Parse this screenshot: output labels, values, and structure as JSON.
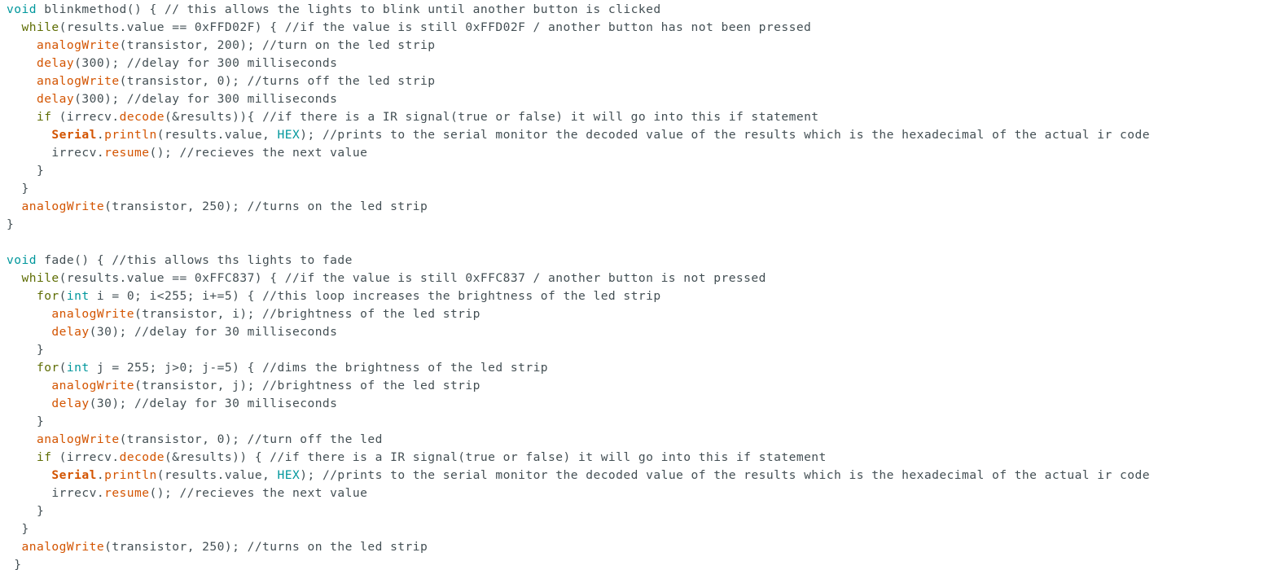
{
  "theme": {
    "background": "#ffffff",
    "default_text": "#434f54",
    "type_color": "#00979c",
    "keyword_color": "#5e6d03",
    "function_color": "#d35400",
    "constant_color": "#00979c"
  },
  "code_lines": [
    [
      [
        "type",
        "void"
      ],
      [
        "text",
        " blinkmethod() { // this allows the lights to blink until another button is clicked"
      ]
    ],
    [
      [
        "text",
        "  "
      ],
      [
        "keyword",
        "while"
      ],
      [
        "text",
        "(results.value == 0xFFD02F) { //if the value is still 0xFFD02F / another button has not been pressed"
      ]
    ],
    [
      [
        "text",
        "    "
      ],
      [
        "func",
        "analogWrite"
      ],
      [
        "text",
        "(transistor, 200); //turn on the led strip"
      ]
    ],
    [
      [
        "text",
        "    "
      ],
      [
        "func",
        "delay"
      ],
      [
        "text",
        "(300); //delay for 300 milliseconds"
      ]
    ],
    [
      [
        "text",
        "    "
      ],
      [
        "func",
        "analogWrite"
      ],
      [
        "text",
        "(transistor, 0); //turns off the led strip"
      ]
    ],
    [
      [
        "text",
        "    "
      ],
      [
        "func",
        "delay"
      ],
      [
        "text",
        "(300); //delay for 300 milliseconds"
      ]
    ],
    [
      [
        "text",
        "    "
      ],
      [
        "keyword",
        "if"
      ],
      [
        "text",
        " (irrecv."
      ],
      [
        "func",
        "decode"
      ],
      [
        "text",
        "(&results)){ //if there is a IR signal(true or false) it will go into this if statement"
      ]
    ],
    [
      [
        "text",
        "      "
      ],
      [
        "serial",
        "Serial"
      ],
      [
        "text",
        "."
      ],
      [
        "func",
        "println"
      ],
      [
        "text",
        "(results.value, "
      ],
      [
        "const",
        "HEX"
      ],
      [
        "text",
        "); //prints to the serial monitor the decoded value of the results which is the hexadecimal of the actual ir code"
      ]
    ],
    [
      [
        "text",
        "      irrecv."
      ],
      [
        "func",
        "resume"
      ],
      [
        "text",
        "(); //recieves the next value"
      ]
    ],
    [
      [
        "text",
        "    }"
      ]
    ],
    [
      [
        "text",
        "  }"
      ]
    ],
    [
      [
        "text",
        "  "
      ],
      [
        "func",
        "analogWrite"
      ],
      [
        "text",
        "(transistor, 250); //turns on the led strip"
      ]
    ],
    [
      [
        "text",
        "}"
      ]
    ],
    [],
    [
      [
        "type",
        "void"
      ],
      [
        "text",
        " fade() { //this allows ths lights to fade"
      ]
    ],
    [
      [
        "text",
        "  "
      ],
      [
        "keyword",
        "while"
      ],
      [
        "text",
        "(results.value == 0xFFC837) { //if the value is still 0xFFC837 / another button is not pressed"
      ]
    ],
    [
      [
        "text",
        "    "
      ],
      [
        "keyword",
        "for"
      ],
      [
        "text",
        "("
      ],
      [
        "type",
        "int"
      ],
      [
        "text",
        " i = 0; i<255; i+=5) { //this loop increases the brightness of the led strip"
      ]
    ],
    [
      [
        "text",
        "      "
      ],
      [
        "func",
        "analogWrite"
      ],
      [
        "text",
        "(transistor, i); //brightness of the led strip"
      ]
    ],
    [
      [
        "text",
        "      "
      ],
      [
        "func",
        "delay"
      ],
      [
        "text",
        "(30); //delay for 30 milliseconds"
      ]
    ],
    [
      [
        "text",
        "    }"
      ]
    ],
    [
      [
        "text",
        "    "
      ],
      [
        "keyword",
        "for"
      ],
      [
        "text",
        "("
      ],
      [
        "type",
        "int"
      ],
      [
        "text",
        " j = 255; j>0; j-=5) { //dims the brightness of the led strip"
      ]
    ],
    [
      [
        "text",
        "      "
      ],
      [
        "func",
        "analogWrite"
      ],
      [
        "text",
        "(transistor, j); //brightness of the led strip"
      ]
    ],
    [
      [
        "text",
        "      "
      ],
      [
        "func",
        "delay"
      ],
      [
        "text",
        "(30); //delay for 30 milliseconds"
      ]
    ],
    [
      [
        "text",
        "    }"
      ]
    ],
    [
      [
        "text",
        "    "
      ],
      [
        "func",
        "analogWrite"
      ],
      [
        "text",
        "(transistor, 0); //turn off the led"
      ]
    ],
    [
      [
        "text",
        "    "
      ],
      [
        "keyword",
        "if"
      ],
      [
        "text",
        " (irrecv."
      ],
      [
        "func",
        "decode"
      ],
      [
        "text",
        "(&results)) { //if there is a IR signal(true or false) it will go into this if statement"
      ]
    ],
    [
      [
        "text",
        "      "
      ],
      [
        "serial",
        "Serial"
      ],
      [
        "text",
        "."
      ],
      [
        "func",
        "println"
      ],
      [
        "text",
        "(results.value, "
      ],
      [
        "const",
        "HEX"
      ],
      [
        "text",
        "); //prints to the serial monitor the decoded value of the results which is the hexadecimal of the actual ir code"
      ]
    ],
    [
      [
        "text",
        "      irrecv."
      ],
      [
        "func",
        "resume"
      ],
      [
        "text",
        "(); //recieves the next value"
      ]
    ],
    [
      [
        "text",
        "    }"
      ]
    ],
    [
      [
        "text",
        "  }"
      ]
    ],
    [
      [
        "text",
        "  "
      ],
      [
        "func",
        "analogWrite"
      ],
      [
        "text",
        "(transistor, 250); //turns on the led strip"
      ]
    ],
    [
      [
        "text",
        " }"
      ]
    ]
  ]
}
